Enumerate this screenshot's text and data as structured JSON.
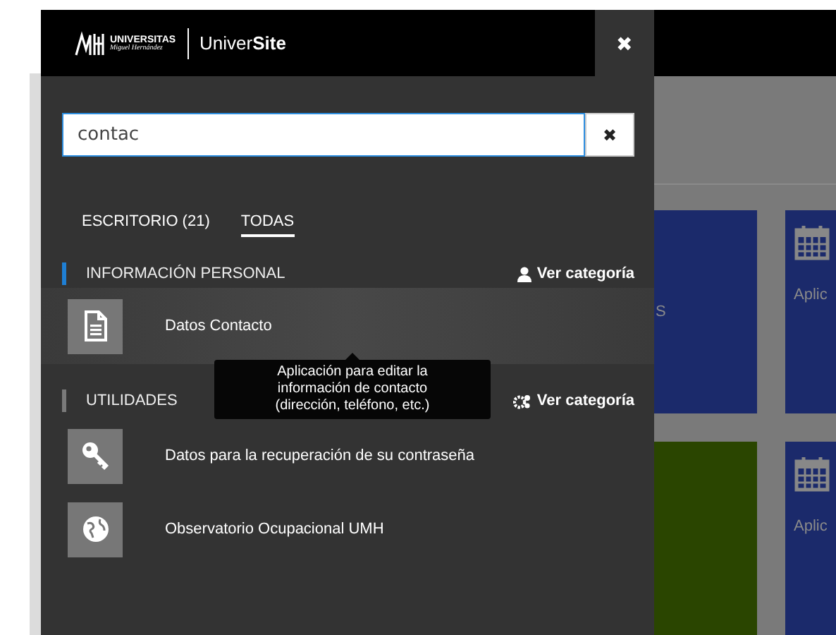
{
  "header": {
    "logo_name": "UNIVERSITAS",
    "logo_subname": "Miguel Hernández",
    "site": "Univer**Site**",
    "close": "✖"
  },
  "search": {
    "value": "contac",
    "clear": "✖"
  },
  "tabs": [
    {
      "label": "ESCRITORIO (21)",
      "selected": false
    },
    {
      "label": "TODAS",
      "selected": true
    }
  ],
  "sections": [
    {
      "title": "INFORMACIÓN PERSONAL",
      "color": "#1f7fd4",
      "link": "Ver categoría",
      "items": [
        {
          "label": "Datos Contacto",
          "highlighted": true
        }
      ]
    },
    {
      "title": "UTILIDADES",
      "color": "#7a7a7a",
      "link": "Ver categoría",
      "items": [
        {
          "label": "Datos para la recuperación de su contraseña",
          "highlighted": false
        },
        {
          "label": "Observatorio Ocupacional UMH",
          "highlighted": false
        }
      ]
    }
  ],
  "tooltip": {
    "lines": [
      "Aplicación para editar la",
      "información de contacto",
      "(dirección, teléfono, etc.)"
    ]
  },
  "background_tiles": [
    {
      "label": "S",
      "color": "#1b2a6b"
    },
    {
      "label": "Aplic",
      "color": "#1b2a6b"
    },
    {
      "color": "#2a4500"
    },
    {
      "label": "Aplic",
      "color": "#1b2a6b"
    }
  ]
}
